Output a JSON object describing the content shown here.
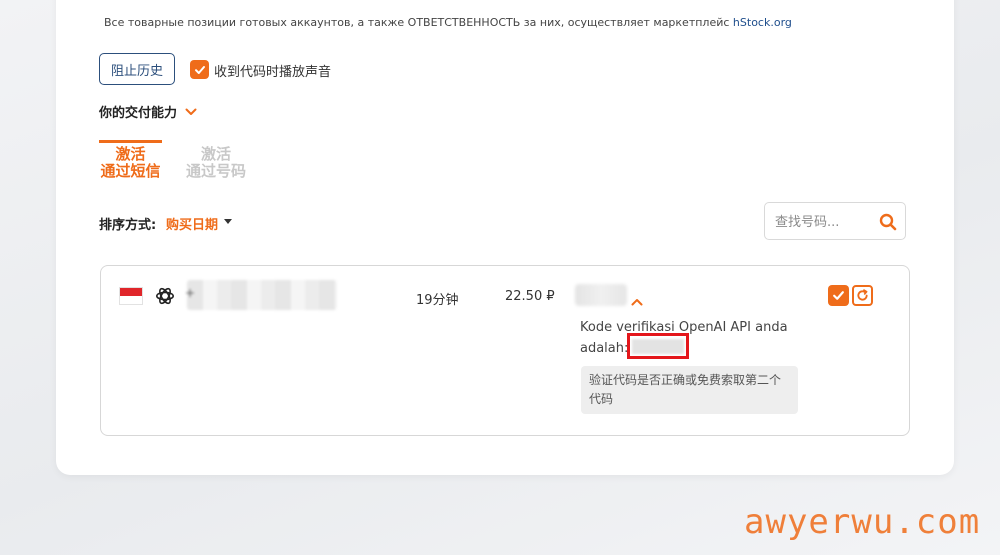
{
  "notice": {
    "text": "Все товарные позиции готовых аккаунтов, а также ОТВЕТСТВЕННОСТЬ за них, осуществляет маркетплейс ",
    "link": "hStock.org"
  },
  "controls": {
    "history_button": "阻止历史",
    "sound_checkbox_label": "收到代码时播放声音",
    "sound_checked": true
  },
  "delivery": {
    "label": "你的交付能力"
  },
  "tabs": [
    {
      "line1": "激活",
      "line2": "通过短信",
      "active": true
    },
    {
      "line1": "激活",
      "line2": "通过号码",
      "active": false
    }
  ],
  "sort": {
    "label": "排序方式:",
    "value": "购买日期"
  },
  "search": {
    "placeholder": "查找号码...",
    "value": ""
  },
  "order": {
    "country": "Indonesia",
    "service": "OpenAI",
    "phone_prefix": "+",
    "duration": "19分钟",
    "price": "22.50 ₽",
    "sms_text": "Kode verifikasi OpenAI API anda adalah:",
    "verify_hint": "验证代码是否正确或免费索取第二个代码"
  },
  "colors": {
    "accent": "#ef6c1a",
    "link": "#1f4e8c",
    "highlight": "#e4161b"
  },
  "watermark": "awyerwu.com"
}
